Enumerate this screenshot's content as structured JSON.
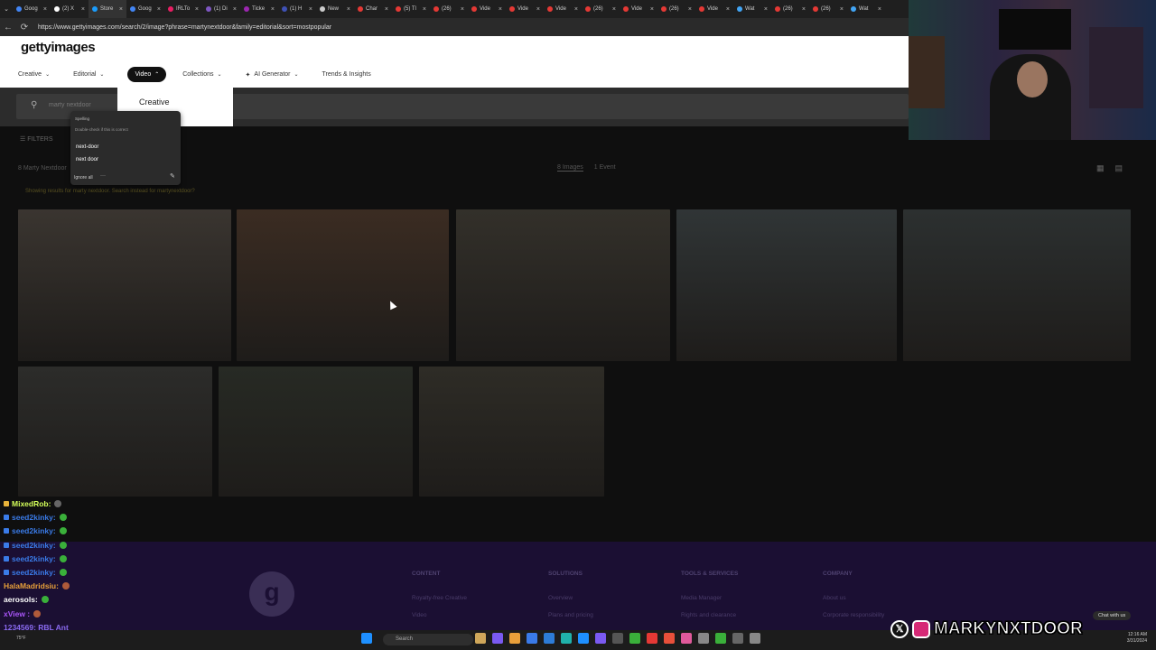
{
  "browser": {
    "tabs": [
      {
        "label": "Goog",
        "color": "#4285f4"
      },
      {
        "label": "(2) X",
        "color": "#ffffff"
      },
      {
        "label": "Store",
        "color": "#1b9cfc"
      },
      {
        "label": "Goog",
        "color": "#4285f4"
      },
      {
        "label": "IRLTo",
        "color": "#e91e63"
      },
      {
        "label": "(1) Di",
        "color": "#7e57c2"
      },
      {
        "label": "Ticke",
        "color": "#9c27b0"
      },
      {
        "label": "(1) H",
        "color": "#3f51b5"
      },
      {
        "label": "New",
        "color": "#cccccc"
      },
      {
        "label": "Char",
        "color": "#e53935"
      },
      {
        "label": "(5) Tl",
        "color": "#e53935"
      },
      {
        "label": "(26)",
        "color": "#e53935"
      },
      {
        "label": "Vide",
        "color": "#e53935"
      },
      {
        "label": "Vide",
        "color": "#e53935"
      },
      {
        "label": "Vide",
        "color": "#e53935"
      },
      {
        "label": "(26)",
        "color": "#e53935"
      },
      {
        "label": "Vide",
        "color": "#e53935"
      },
      {
        "label": "(26)",
        "color": "#e53935"
      },
      {
        "label": "Vide",
        "color": "#e53935"
      },
      {
        "label": "Wat",
        "color": "#42a5f5"
      },
      {
        "label": "(26)",
        "color": "#e53935"
      },
      {
        "label": "(26)",
        "color": "#e53935"
      },
      {
        "label": "Wat",
        "color": "#42a5f5"
      }
    ],
    "tab_close": "×",
    "url": "https://www.gettyimages.com/search/2/image?phrase=martynextdoor&family=editorial&sort=mostpopular",
    "back": "←",
    "reload": "⟳"
  },
  "site": {
    "logo": "gettyimages",
    "nav": [
      {
        "label": "Creative",
        "chev": "⌄"
      },
      {
        "label": "Editorial",
        "chev": "⌄"
      },
      {
        "label": "Video",
        "chev": "⌃"
      },
      {
        "label": "Collections",
        "chev": "⌄"
      },
      {
        "label": "AI Generator",
        "chev": "⌄",
        "spark": "✦"
      },
      {
        "label": "Trends & Insights",
        "chev": ""
      }
    ],
    "dropdown_item": "Creative",
    "search_value": "marty nextdoor",
    "search_icon": "search-icon",
    "filters": "☰   FILTERS",
    "results_count": "8 Marty Nextdoor",
    "result_tabs": [
      "8 Images",
      "1 Event"
    ],
    "view_icons": [
      "▦",
      "▤"
    ],
    "suggestion": "Showing results for marty nextdoor. Search instead for martynextdoor?"
  },
  "spellcheck": {
    "title": "Spelling",
    "description": "Double-check if this is correct",
    "suggestions": [
      "next-door",
      "next door"
    ],
    "ignore": "Ignore all",
    "more": "···",
    "pen": "✎"
  },
  "images": [
    {
      "color": "#3a3530"
    },
    {
      "color": "#3b2c22"
    },
    {
      "color": "#33302a"
    },
    {
      "color": "#303536"
    },
    {
      "color": "#2c3030"
    },
    {
      "color": "#2c2c2a"
    },
    {
      "color": "#272a24"
    },
    {
      "color": "#2e2c26"
    }
  ],
  "footer": {
    "logo_letter": "g",
    "columns": [
      {
        "heading": "CONTENT",
        "links": [
          "Royalty-free Creative",
          "Video"
        ]
      },
      {
        "heading": "SOLUTIONS",
        "links": [
          "Overview",
          "Plans and pricing"
        ]
      },
      {
        "heading": "TOOLS & SERVICES",
        "links": [
          "Media Manager",
          "Rights and clearance"
        ]
      },
      {
        "heading": "COMPANY",
        "links": [
          "About us",
          "Corporate responsibility"
        ]
      }
    ]
  },
  "chat": [
    {
      "user": "MixedRob:",
      "color": "#d4ff5a",
      "badge": "#e8b33a",
      "emote": "#666"
    },
    {
      "user": "seed2kinky:",
      "color": "#3a7be8",
      "badge": "#3a7be8",
      "emote": "#3ab03a"
    },
    {
      "user": "seed2kinky:",
      "color": "#3a7be8",
      "badge": "#3a7be8",
      "emote": "#3ab03a"
    },
    {
      "user": "seed2kinky:",
      "color": "#3a7be8",
      "badge": "#3a7be8",
      "emote": "#3ab03a"
    },
    {
      "user": "seed2kinky:",
      "color": "#3a7be8",
      "badge": "#3a7be8",
      "emote": "#3ab03a"
    },
    {
      "user": "seed2kinky:",
      "color": "#3a7be8",
      "badge": "#3a7be8",
      "emote": "#3ab03a"
    },
    {
      "user": "HalaMadridsiu:",
      "color": "#e8a03a",
      "badge": "",
      "emote": "#b05a3a"
    },
    {
      "user": "aerosols:",
      "color": "#ffffff",
      "badge": "",
      "emote": "#3ab03a"
    },
    {
      "user": "xView :",
      "color": "#a855f7",
      "badge": "",
      "emote": "#b05a3a"
    },
    {
      "user": "1234569: RBL Ant",
      "color": "#8a6af0",
      "badge": "",
      "emote": ""
    }
  ],
  "taskbar": {
    "weather": "75°F",
    "search": "Search",
    "time": "12:16 AM",
    "date": "3/31/2024",
    "chat_with_us": "Chat with us",
    "icons": [
      "#1e90ff",
      "#888",
      "#cfa75a",
      "#7a5af0",
      "#e8a03a",
      "#3a7be8",
      "#2d7cd6",
      "#20b2aa",
      "#1e90ff",
      "#7a5af0",
      "#555",
      "#3ab03a",
      "#e53935",
      "#e8503a",
      "#e05a9a",
      "#888",
      "#3ab03a",
      "#666",
      "#888"
    ]
  },
  "branding": {
    "x": "𝕏",
    "name": "MARKYNXTDOOR"
  }
}
